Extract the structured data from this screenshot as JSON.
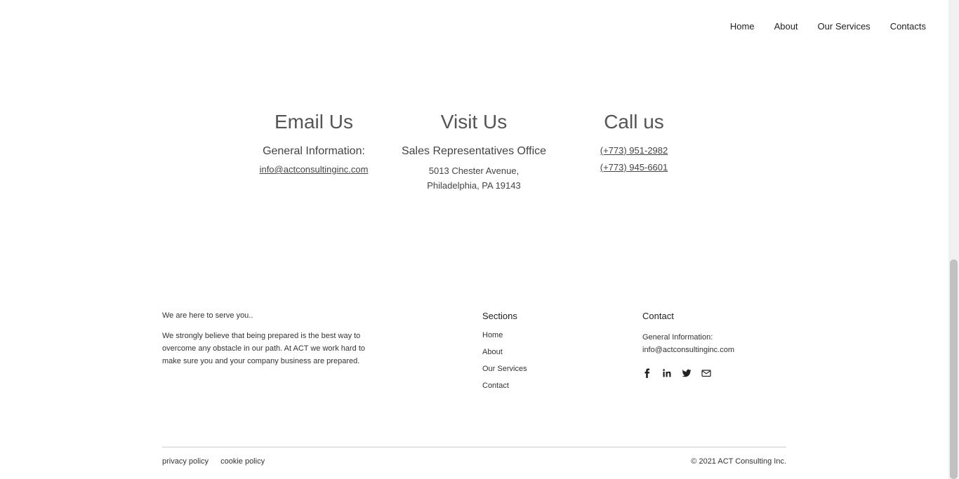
{
  "nav": {
    "items": [
      "Home",
      "About",
      "Our Services",
      "Contacts"
    ]
  },
  "email_col": {
    "title": "Email Us",
    "subtitle": "General Information:",
    "email": "info@actconsultinginc.com"
  },
  "visit_col": {
    "title": "Visit Us",
    "subtitle": "Sales Representatives Office",
    "address_line1": "5013 Chester Avenue,",
    "address_line2": "Philadelphia, PA 19143"
  },
  "call_col": {
    "title": "Call us",
    "phone1": "(+773) 951-2982",
    "phone2": "(+773) 945-6601"
  },
  "footer": {
    "tagline": "We are here to serve you..",
    "paragraph": "We strongly believe that being prepared is the best way to overcome any obstacle in our path. At ACT we work hard to make sure you and your company business are prepared.",
    "sections_title": "Sections",
    "sections": [
      "Home",
      "About",
      "Our Services",
      "Contact"
    ],
    "contact_title": "Contact",
    "contact_label": "General Information:",
    "contact_email": "info@actconsultinginc.com",
    "social_icons": [
      "facebook-icon",
      "linkedin-icon",
      "twitter-icon",
      "mail-icon"
    ],
    "privacy": "privacy policy",
    "cookie": "cookie policy",
    "copyright": "© 2021 ACT Consulting Inc."
  }
}
